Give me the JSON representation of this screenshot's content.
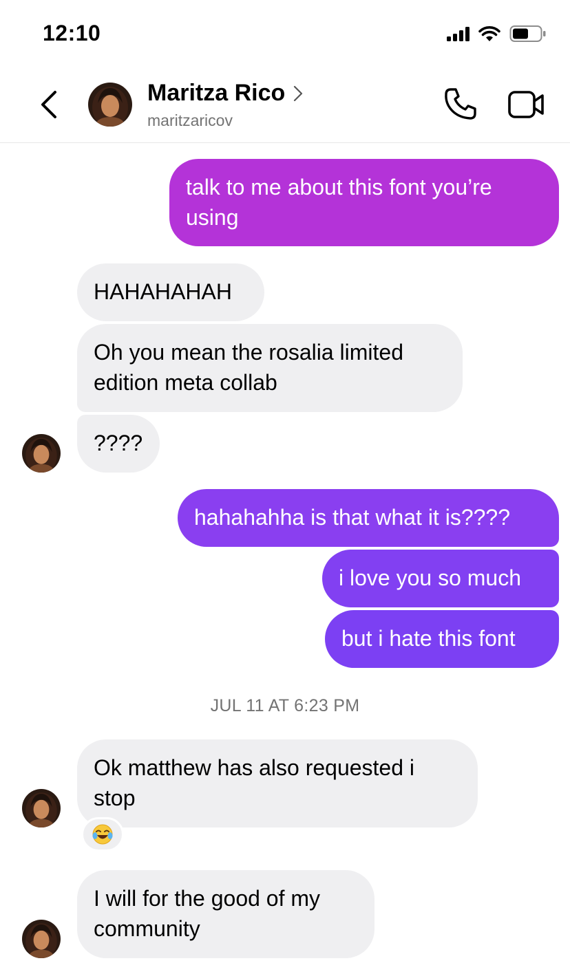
{
  "status_bar": {
    "time": "12:10"
  },
  "header": {
    "name": "Maritza Rico",
    "username": "maritzaricov"
  },
  "messages": [
    {
      "from": "me",
      "text": "talk to me about this font you’re using",
      "color": "#b433d8"
    },
    {
      "from": "them",
      "text": "HAHAHAHAH"
    },
    {
      "from": "them",
      "text": "Oh you mean the rosalia limited edition meta collab"
    },
    {
      "from": "them",
      "text": "????"
    },
    {
      "from": "me",
      "text": "hahahahha is that what it is????",
      "color": "#8a3ff0"
    },
    {
      "from": "me",
      "text": "i love you so much",
      "color": "#8240f2"
    },
    {
      "from": "me",
      "text": "but i hate this font",
      "color": "#7c40f3"
    },
    {
      "from": "them",
      "text": "Ok matthew has also requested i stop",
      "reaction": "face-with-tears-of-joy"
    },
    {
      "from": "them",
      "text": "I will for the good of my community"
    }
  ],
  "timestamp": "JUL 11 AT 6:23 PM",
  "colors": {
    "incoming_bubble": "#efeff1",
    "secondary_text": "#737373"
  }
}
